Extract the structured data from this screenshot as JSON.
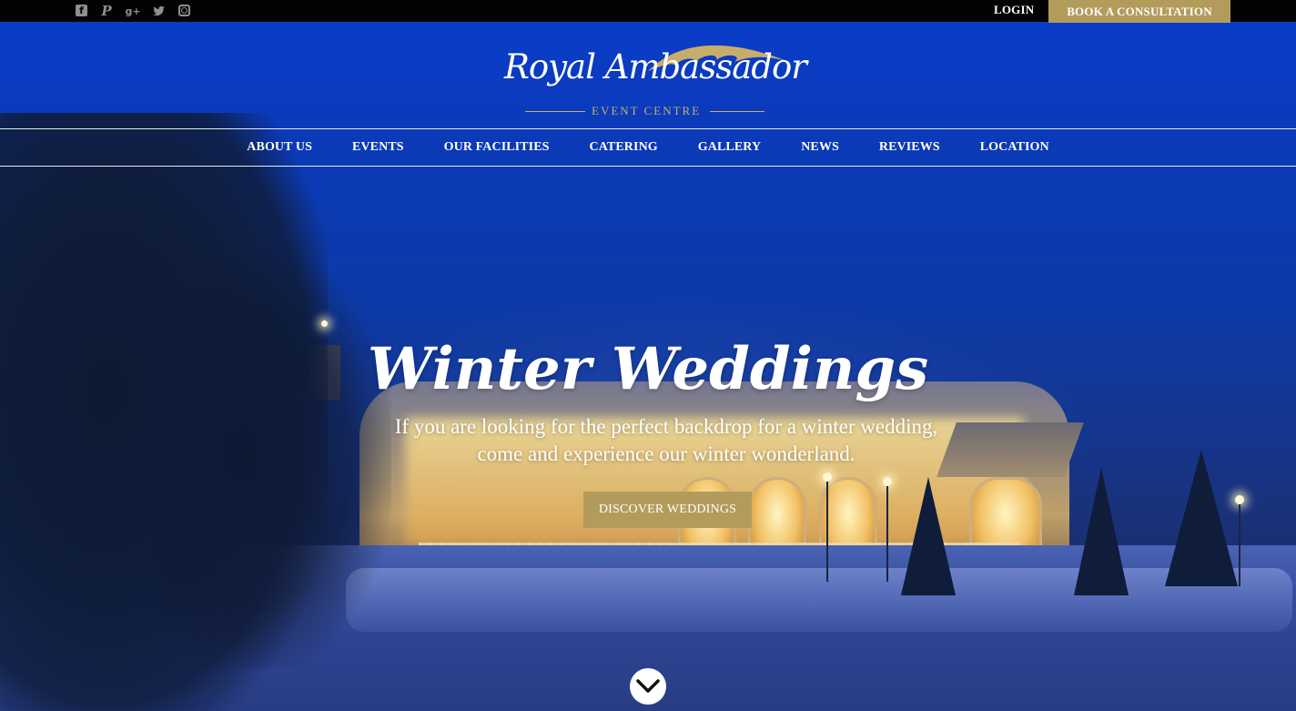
{
  "topbar": {
    "social": [
      {
        "name": "facebook-icon",
        "glyph": "f"
      },
      {
        "name": "pinterest-icon",
        "glyph": "P"
      },
      {
        "name": "google-plus-icon",
        "glyph": "g+"
      },
      {
        "name": "twitter-icon",
        "glyph": "🐦"
      },
      {
        "name": "instagram-icon",
        "glyph": ""
      }
    ],
    "login_label": "LOGIN",
    "consult_label": "BOOK A CONSULTATION"
  },
  "logo": {
    "name": "Royal Ambassador",
    "subtitle": "EVENT CENTRE"
  },
  "nav": {
    "items": [
      "ABOUT US",
      "EVENTS",
      "OUR FACILITIES",
      "CATERING",
      "GALLERY",
      "NEWS",
      "REVIEWS",
      "LOCATION"
    ]
  },
  "hero": {
    "title": "Winter Weddings",
    "subtitle": "If you are looking for the perfect backdrop for a winter wedding, come and experience our winter wonderland.",
    "cta_label": "DISCOVER WEDDINGS",
    "scroll_icon": "chevron-down-icon"
  },
  "colors": {
    "accent_gold": "#b39b5c",
    "topbar_bg": "#030303",
    "sky_blue": "#0a3cc9"
  }
}
